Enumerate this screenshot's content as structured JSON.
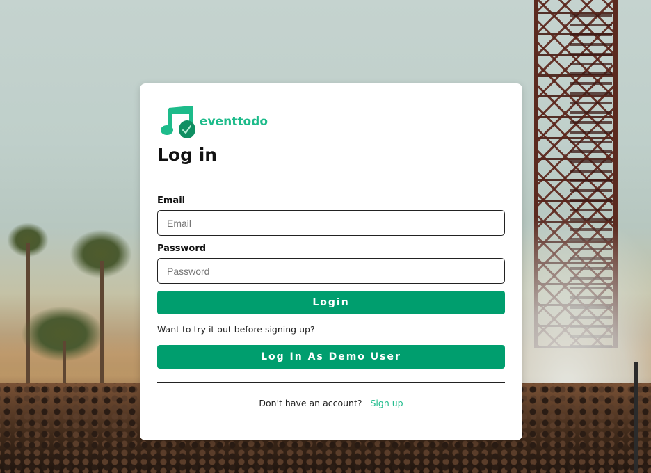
{
  "brand": {
    "name": "eventtodo",
    "logo_icon": "music-note-check-icon",
    "accent_color": "#1dbb8a"
  },
  "form": {
    "title": "Log in",
    "email_label": "Email",
    "email_placeholder": "Email",
    "email_value": "",
    "password_label": "Password",
    "password_placeholder": "Password",
    "password_value": "",
    "login_button": "Login",
    "demo_hint": "Want to try it out before signing up?",
    "demo_button": "Log In As Demo User",
    "button_color": "#009e6e"
  },
  "footer": {
    "prompt": "Don't have an account?",
    "signup_link": "Sign up"
  }
}
